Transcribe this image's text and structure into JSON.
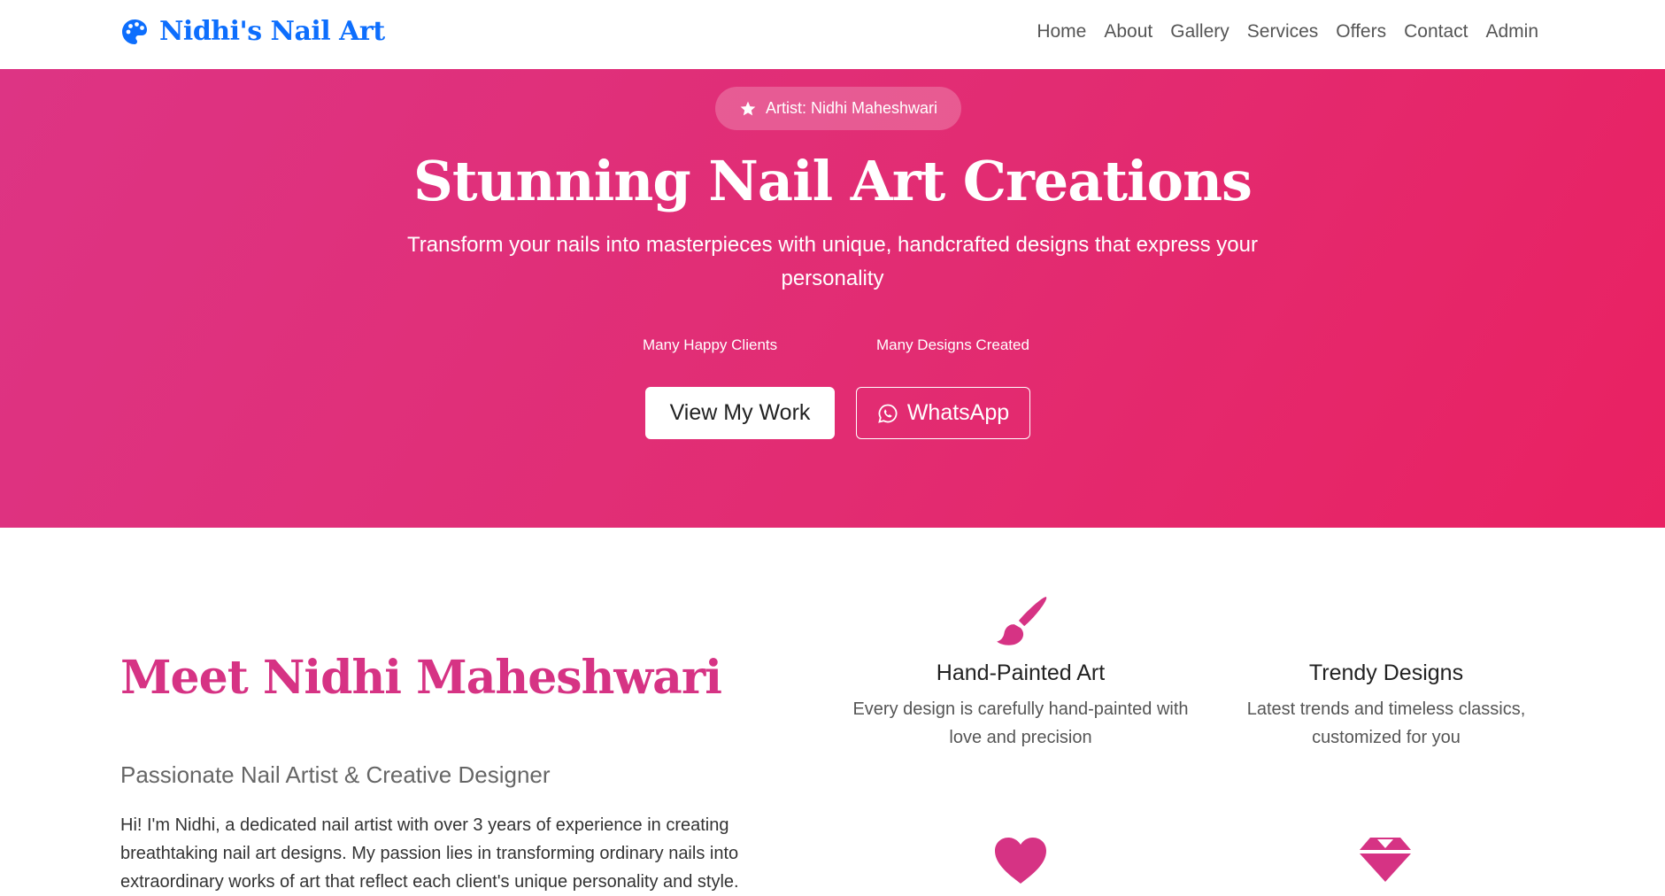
{
  "nav": {
    "brand": "Nidhi's Nail Art",
    "links": [
      "Home",
      "About",
      "Gallery",
      "Services",
      "Offers",
      "Contact",
      "Admin"
    ]
  },
  "hero": {
    "badge": "Artist: Nidhi Maheshwari",
    "title": "Stunning Nail Art Creations",
    "subtitle": "Transform your nails into masterpieces with unique, handcrafted designs that express your personality",
    "stats": [
      "Many Happy Clients",
      "Many Designs Created"
    ],
    "primary_button": "View My Work",
    "secondary_button": "WhatsApp"
  },
  "about": {
    "title": "Meet Nidhi Maheshwari",
    "subtitle": "Passionate Nail Artist & Creative Designer",
    "text": "Hi! I'm Nidhi, a dedicated nail artist with over 3 years of experience in creating breathtaking nail art designs. My passion lies in transforming ordinary nails into extraordinary works of art that reflect each client's unique personality and style."
  },
  "features": [
    {
      "icon": "paintbrush-icon",
      "title": "Hand-Painted Art",
      "desc": "Every design is carefully hand-painted with love and precision"
    },
    {
      "icon": "star-sparkle-icon",
      "title": "Trendy Designs",
      "desc": "Latest trends and timeless classics, customized for you"
    },
    {
      "icon": "heart-icon",
      "title": "",
      "desc": ""
    },
    {
      "icon": "gem-icon",
      "title": "",
      "desc": ""
    }
  ],
  "colors": {
    "brand": "#0d6efd",
    "accent": "#d63384",
    "hero_start": "#dd3484",
    "hero_end": "#e92162"
  }
}
